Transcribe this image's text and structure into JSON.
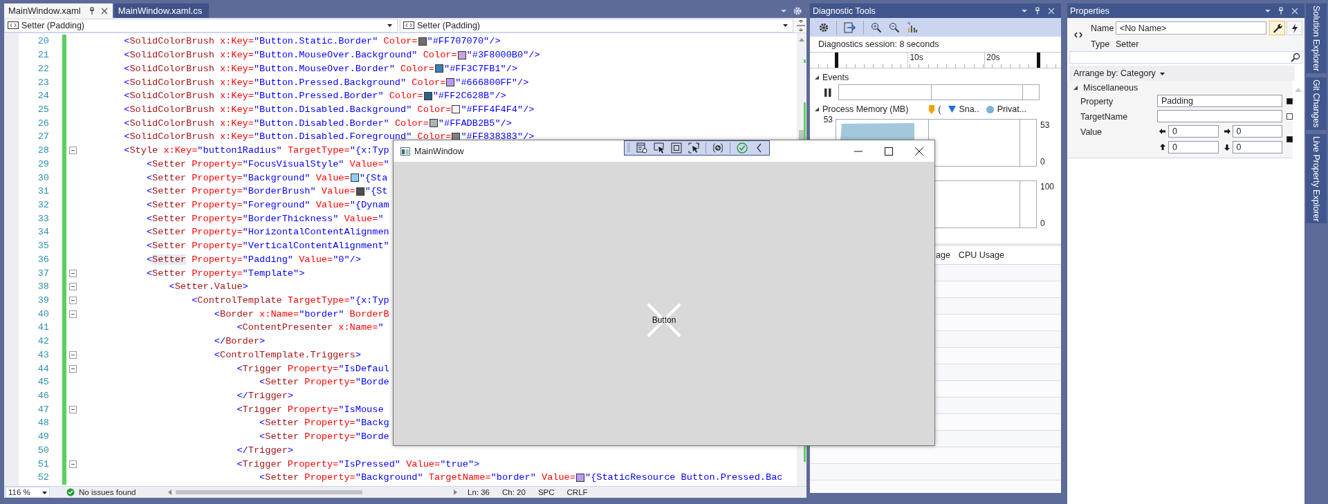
{
  "editor": {
    "tabs": [
      {
        "label": "MainWindow.xaml",
        "selected": true
      },
      {
        "label": "MainWindow.xaml.cs",
        "selected": false
      }
    ],
    "nav": [
      {
        "label": "Setter (Padding)"
      },
      {
        "label": "Setter (Padding)"
      }
    ],
    "lines": [
      {
        "number": "20",
        "changed": true,
        "fold": false,
        "tokens": [
          {
            "kind": "punct",
            "text": "        <"
          },
          {
            "kind": "tag",
            "text": "SolidColorBrush"
          },
          {
            "kind": "attr",
            "text": " x:Key="
          },
          {
            "kind": "value",
            "text": "\"Button.Static.Border\""
          },
          {
            "kind": "attr",
            "text": " Color="
          },
          {
            "kind": "swatch",
            "color": "#707070"
          },
          {
            "kind": "value",
            "text": "\"#FF707070\"/>"
          }
        ]
      },
      {
        "number": "21",
        "changed": true,
        "fold": false,
        "tokens": [
          {
            "kind": "punct",
            "text": "        <"
          },
          {
            "kind": "tag",
            "text": "SolidColorBrush"
          },
          {
            "kind": "attr",
            "text": " x:Key="
          },
          {
            "kind": "value",
            "text": "\"Button.MouseOver.Background\""
          },
          {
            "kind": "attr",
            "text": " Color="
          },
          {
            "kind": "swatch",
            "color": "#c9a3df"
          },
          {
            "kind": "value",
            "text": "\"#3F8000B0\"/>"
          }
        ]
      },
      {
        "number": "22",
        "changed": true,
        "fold": false,
        "tokens": [
          {
            "kind": "punct",
            "text": "        <"
          },
          {
            "kind": "tag",
            "text": "SolidColorBrush"
          },
          {
            "kind": "attr",
            "text": " x:Key="
          },
          {
            "kind": "value",
            "text": "\"Button.MouseOver.Border\""
          },
          {
            "kind": "attr",
            "text": " Color="
          },
          {
            "kind": "swatch",
            "color": "#3c7fb1"
          },
          {
            "kind": "value",
            "text": "\"#FF3C7FB1\"/>"
          }
        ]
      },
      {
        "number": "23",
        "changed": true,
        "fold": false,
        "tokens": [
          {
            "kind": "punct",
            "text": "        <"
          },
          {
            "kind": "tag",
            "text": "SolidColorBrush"
          },
          {
            "kind": "attr",
            "text": " x:Key="
          },
          {
            "kind": "value",
            "text": "\"Button.Pressed.Background\""
          },
          {
            "kind": "attr",
            "text": " Color="
          },
          {
            "kind": "swatch",
            "color": "#b899ff"
          },
          {
            "kind": "value",
            "text": "\"#666800FF\"/>"
          }
        ]
      },
      {
        "number": "24",
        "changed": true,
        "fold": false,
        "tokens": [
          {
            "kind": "punct",
            "text": "        <"
          },
          {
            "kind": "tag",
            "text": "SolidColorBrush"
          },
          {
            "kind": "attr",
            "text": " x:Key="
          },
          {
            "kind": "value",
            "text": "\"Button.Pressed.Border\""
          },
          {
            "kind": "attr",
            "text": " Color="
          },
          {
            "kind": "swatch",
            "color": "#2c628b"
          },
          {
            "kind": "value",
            "text": "\"#FF2C628B\"/>"
          }
        ]
      },
      {
        "number": "25",
        "changed": true,
        "fold": false,
        "tokens": [
          {
            "kind": "punct",
            "text": "        <"
          },
          {
            "kind": "tag",
            "text": "SolidColorBrush"
          },
          {
            "kind": "attr",
            "text": " x:Key="
          },
          {
            "kind": "value",
            "text": "\"Button.Disabled.Background\""
          },
          {
            "kind": "attr",
            "text": " Color="
          },
          {
            "kind": "swatch",
            "color": "#f4f4f4"
          },
          {
            "kind": "value",
            "text": "\"#FFF4F4F4\"/>"
          }
        ]
      },
      {
        "number": "26",
        "changed": true,
        "fold": false,
        "tokens": [
          {
            "kind": "punct",
            "text": "        <"
          },
          {
            "kind": "tag",
            "text": "SolidColorBrush"
          },
          {
            "kind": "attr",
            "text": " x:Key="
          },
          {
            "kind": "value",
            "text": "\"Button.Disabled.Border\""
          },
          {
            "kind": "attr",
            "text": " Color="
          },
          {
            "kind": "swatch",
            "color": "#adb2b5"
          },
          {
            "kind": "value",
            "text": "\"#FFADB2B5\"/>"
          }
        ]
      },
      {
        "number": "27",
        "changed": true,
        "fold": false,
        "tokens": [
          {
            "kind": "punct",
            "text": "        <"
          },
          {
            "kind": "tag",
            "text": "SolidColorBrush"
          },
          {
            "kind": "attr",
            "text": " x:Key="
          },
          {
            "kind": "value",
            "text": "\"Button.Disabled.Foreground\""
          },
          {
            "kind": "attr",
            "text": " Color="
          },
          {
            "kind": "swatch",
            "color": "#838383"
          },
          {
            "kind": "value",
            "text": "\"#FF838383\"/>"
          }
        ]
      },
      {
        "number": "28",
        "changed": true,
        "fold": true,
        "tokens": [
          {
            "kind": "punct",
            "text": "        <"
          },
          {
            "kind": "tag",
            "text": "Style"
          },
          {
            "kind": "attr",
            "text": " x:Key="
          },
          {
            "kind": "value",
            "text": "\"button1Radius\""
          },
          {
            "kind": "attr",
            "text": " TargetType="
          },
          {
            "kind": "value",
            "text": "\"{x:Typ"
          }
        ]
      },
      {
        "number": "29",
        "changed": true,
        "fold": false,
        "tokens": [
          {
            "kind": "punct",
            "text": "            <"
          },
          {
            "kind": "tag",
            "text": "Setter"
          },
          {
            "kind": "attr",
            "text": " Property="
          },
          {
            "kind": "value",
            "text": "\"FocusVisualStyle\""
          },
          {
            "kind": "attr",
            "text": " Value="
          },
          {
            "kind": "value",
            "text": "\""
          }
        ]
      },
      {
        "number": "30",
        "changed": true,
        "fold": false,
        "tokens": [
          {
            "kind": "punct",
            "text": "            <"
          },
          {
            "kind": "tag",
            "text": "Setter"
          },
          {
            "kind": "attr",
            "text": " Property="
          },
          {
            "kind": "value",
            "text": "\"Background\""
          },
          {
            "kind": "attr",
            "text": " Value="
          },
          {
            "kind": "swatch",
            "color": "#8fd0f2"
          },
          {
            "kind": "value",
            "text": "\"{Sta"
          }
        ]
      },
      {
        "number": "31",
        "changed": true,
        "fold": false,
        "tokens": [
          {
            "kind": "punct",
            "text": "            <"
          },
          {
            "kind": "tag",
            "text": "Setter"
          },
          {
            "kind": "attr",
            "text": " Property="
          },
          {
            "kind": "value",
            "text": "\"BorderBrush\""
          },
          {
            "kind": "attr",
            "text": " Value="
          },
          {
            "kind": "swatch",
            "color": "#4f4f4f"
          },
          {
            "kind": "value",
            "text": "\"{St"
          }
        ]
      },
      {
        "number": "32",
        "changed": true,
        "fold": false,
        "tokens": [
          {
            "kind": "punct",
            "text": "            <"
          },
          {
            "kind": "tag",
            "text": "Setter"
          },
          {
            "kind": "attr",
            "text": " Property="
          },
          {
            "kind": "value",
            "text": "\"Foreground\""
          },
          {
            "kind": "attr",
            "text": " Value="
          },
          {
            "kind": "value",
            "text": "\"{Dynam"
          }
        ]
      },
      {
        "number": "33",
        "changed": true,
        "fold": false,
        "tokens": [
          {
            "kind": "punct",
            "text": "            <"
          },
          {
            "kind": "tag",
            "text": "Setter"
          },
          {
            "kind": "attr",
            "text": " Property="
          },
          {
            "kind": "value",
            "text": "\"BorderThickness\""
          },
          {
            "kind": "attr",
            "text": " Value="
          },
          {
            "kind": "value",
            "text": "\""
          }
        ]
      },
      {
        "number": "34",
        "changed": true,
        "fold": false,
        "tokens": [
          {
            "kind": "punct",
            "text": "            <"
          },
          {
            "kind": "tag",
            "text": "Setter"
          },
          {
            "kind": "attr",
            "text": " Property="
          },
          {
            "kind": "value",
            "text": "\"HorizontalContentAlignmen"
          }
        ]
      },
      {
        "number": "35",
        "changed": true,
        "fold": false,
        "tokens": [
          {
            "kind": "punct",
            "text": "            <"
          },
          {
            "kind": "tag",
            "text": "Setter"
          },
          {
            "kind": "attr",
            "text": " Property="
          },
          {
            "kind": "value",
            "text": "\"VerticalContentAlignment\""
          }
        ]
      },
      {
        "number": "36",
        "changed": true,
        "fold": false,
        "tokens": [
          {
            "kind": "punct",
            "text": "            <"
          },
          {
            "kind": "tag",
            "text": "Setter",
            "highlighted": true
          },
          {
            "kind": "attr",
            "text": " Property="
          },
          {
            "kind": "value",
            "text": "\"Padding\""
          },
          {
            "kind": "attr",
            "text": " Value="
          },
          {
            "kind": "value",
            "text": "\"0\"/>"
          }
        ]
      },
      {
        "number": "37",
        "changed": true,
        "fold": true,
        "tokens": [
          {
            "kind": "punct",
            "text": "            <"
          },
          {
            "kind": "tag",
            "text": "Setter"
          },
          {
            "kind": "attr",
            "text": " Property="
          },
          {
            "kind": "value",
            "text": "\"Template\">"
          }
        ]
      },
      {
        "number": "38",
        "changed": true,
        "fold": true,
        "tokens": [
          {
            "kind": "punct",
            "text": "                <"
          },
          {
            "kind": "tag",
            "text": "Setter.Value"
          },
          {
            "kind": "punct",
            "text": ">"
          }
        ]
      },
      {
        "number": "39",
        "changed": true,
        "fold": true,
        "tokens": [
          {
            "kind": "punct",
            "text": "                    <"
          },
          {
            "kind": "tag",
            "text": "ControlTemplate"
          },
          {
            "kind": "attr",
            "text": " TargetType="
          },
          {
            "kind": "value",
            "text": "\"{x:Typ"
          }
        ]
      },
      {
        "number": "40",
        "changed": true,
        "fold": true,
        "tokens": [
          {
            "kind": "punct",
            "text": "                        <"
          },
          {
            "kind": "tag",
            "text": "Border"
          },
          {
            "kind": "attr",
            "text": " x:Name="
          },
          {
            "kind": "value",
            "text": "\"border\""
          },
          {
            "kind": "attr",
            "text": " BorderB"
          }
        ]
      },
      {
        "number": "41",
        "changed": true,
        "fold": false,
        "tokens": [
          {
            "kind": "punct",
            "text": "                            <"
          },
          {
            "kind": "tag",
            "text": "ContentPresenter"
          },
          {
            "kind": "attr",
            "text": " x:Name="
          },
          {
            "kind": "value",
            "text": "\""
          }
        ]
      },
      {
        "number": "42",
        "changed": true,
        "fold": false,
        "tokens": [
          {
            "kind": "punct",
            "text": "                        </"
          },
          {
            "kind": "tag",
            "text": "Border"
          },
          {
            "kind": "punct",
            "text": ">"
          }
        ]
      },
      {
        "number": "43",
        "changed": true,
        "fold": true,
        "tokens": [
          {
            "kind": "punct",
            "text": "                        <"
          },
          {
            "kind": "tag",
            "text": "ControlTemplate.Triggers"
          },
          {
            "kind": "punct",
            "text": ">"
          }
        ]
      },
      {
        "number": "44",
        "changed": true,
        "fold": true,
        "tokens": [
          {
            "kind": "punct",
            "text": "                            <"
          },
          {
            "kind": "tag",
            "text": "Trigger"
          },
          {
            "kind": "attr",
            "text": " Property="
          },
          {
            "kind": "value",
            "text": "\"IsDefaul"
          }
        ]
      },
      {
        "number": "45",
        "changed": true,
        "fold": false,
        "tokens": [
          {
            "kind": "punct",
            "text": "                                <"
          },
          {
            "kind": "tag",
            "text": "Setter"
          },
          {
            "kind": "attr",
            "text": " Property="
          },
          {
            "kind": "value",
            "text": "\"Borde"
          }
        ]
      },
      {
        "number": "46",
        "changed": true,
        "fold": false,
        "tokens": [
          {
            "kind": "punct",
            "text": "                            </"
          },
          {
            "kind": "tag",
            "text": "Trigger"
          },
          {
            "kind": "punct",
            "text": ">"
          }
        ]
      },
      {
        "number": "47",
        "changed": true,
        "fold": true,
        "tokens": [
          {
            "kind": "punct",
            "text": "                            <"
          },
          {
            "kind": "tag",
            "text": "Trigger"
          },
          {
            "kind": "attr",
            "text": " Property="
          },
          {
            "kind": "value",
            "text": "\"IsMouse"
          }
        ]
      },
      {
        "number": "48",
        "changed": true,
        "fold": false,
        "tokens": [
          {
            "kind": "punct",
            "text": "                                <"
          },
          {
            "kind": "tag",
            "text": "Setter"
          },
          {
            "kind": "attr",
            "text": " Property="
          },
          {
            "kind": "value",
            "text": "\"Backg"
          }
        ]
      },
      {
        "number": "49",
        "changed": true,
        "fold": false,
        "tokens": [
          {
            "kind": "punct",
            "text": "                                <"
          },
          {
            "kind": "tag",
            "text": "Setter"
          },
          {
            "kind": "attr",
            "text": " Property="
          },
          {
            "kind": "value",
            "text": "\"Borde"
          }
        ]
      },
      {
        "number": "50",
        "changed": true,
        "fold": false,
        "tokens": [
          {
            "kind": "punct",
            "text": "                            </"
          },
          {
            "kind": "tag",
            "text": "Trigger"
          },
          {
            "kind": "punct",
            "text": ">"
          }
        ]
      },
      {
        "number": "51",
        "changed": true,
        "fold": true,
        "tokens": [
          {
            "kind": "punct",
            "text": "                            <"
          },
          {
            "kind": "tag",
            "text": "Trigger"
          },
          {
            "kind": "attr",
            "text": " Property="
          },
          {
            "kind": "value",
            "text": "\"IsPressed\""
          },
          {
            "kind": "attr",
            "text": " Value="
          },
          {
            "kind": "value",
            "text": "\"true\">"
          }
        ]
      },
      {
        "number": "52",
        "changed": true,
        "fold": false,
        "tokens": [
          {
            "kind": "punct",
            "text": "                                <"
          },
          {
            "kind": "tag",
            "text": "Setter"
          },
          {
            "kind": "attr",
            "text": " Property="
          },
          {
            "kind": "value",
            "text": "\"Background\""
          },
          {
            "kind": "attr",
            "text": " TargetName="
          },
          {
            "kind": "value",
            "text": "\"border\""
          },
          {
            "kind": "attr",
            "text": " Value="
          },
          {
            "kind": "swatch",
            "color": "#b899ff"
          },
          {
            "kind": "value",
            "text": "\"{StaticResource Button.Pressed.Bac"
          }
        ]
      }
    ],
    "status": {
      "zoom": "116 %",
      "issues": "No issues found",
      "line": "Ln: 36",
      "column": "Ch: 20",
      "whitespace": "SPC",
      "line_ending": "CRLF"
    }
  },
  "diagnostic_tools": {
    "title": "Diagnostic Tools",
    "session": "Diagnostics session: 8 seconds",
    "ruler": [
      "10s",
      "20s"
    ],
    "events": {
      "label": "Events",
      "expanded": true
    },
    "memory": {
      "label": "Process Memory (MB)",
      "expanded": true,
      "legend": [
        {
          "kind": "marker",
          "label": "(",
          "color": "#f5a300"
        },
        {
          "kind": "triangle",
          "label": "Sna..",
          "color": "#1e6fd9"
        },
        {
          "kind": "circle",
          "label": "Privat...",
          "color": "#7fb2d3"
        }
      ],
      "left_labels": [
        "53"
      ],
      "right_labels": [
        "53",
        "0"
      ]
    },
    "cpu": {
      "right_labels": [
        "100",
        "0"
      ]
    },
    "tabs": [
      {
        "label": "age",
        "selected": false
      },
      {
        "label": "CPU Usage",
        "selected": false
      }
    ]
  },
  "properties": {
    "title": "Properties",
    "name_label": "Name",
    "name_value": "<No Name>",
    "type_label": "Type",
    "type_value": "Setter",
    "mode_buttons": [
      {
        "kind": "properties",
        "selected": true
      },
      {
        "kind": "events",
        "selected": false
      }
    ],
    "arrange": "Arrange by: Category",
    "category": {
      "label": "Miscellaneous",
      "expanded": true,
      "rows": [
        {
          "kind": "text",
          "label": "Property",
          "value": "Padding",
          "set": true
        },
        {
          "kind": "text",
          "label": "TargetName",
          "set": false
        },
        {
          "kind": "thickness",
          "label": "Value",
          "values": [
            "0",
            "0",
            "0",
            "0"
          ],
          "set": true
        }
      ]
    }
  },
  "side_tabs": [
    "Solution Explorer",
    "Git Changes",
    "Live Property Explorer"
  ],
  "app_window": {
    "title": "MainWindow",
    "button": "Button"
  }
}
